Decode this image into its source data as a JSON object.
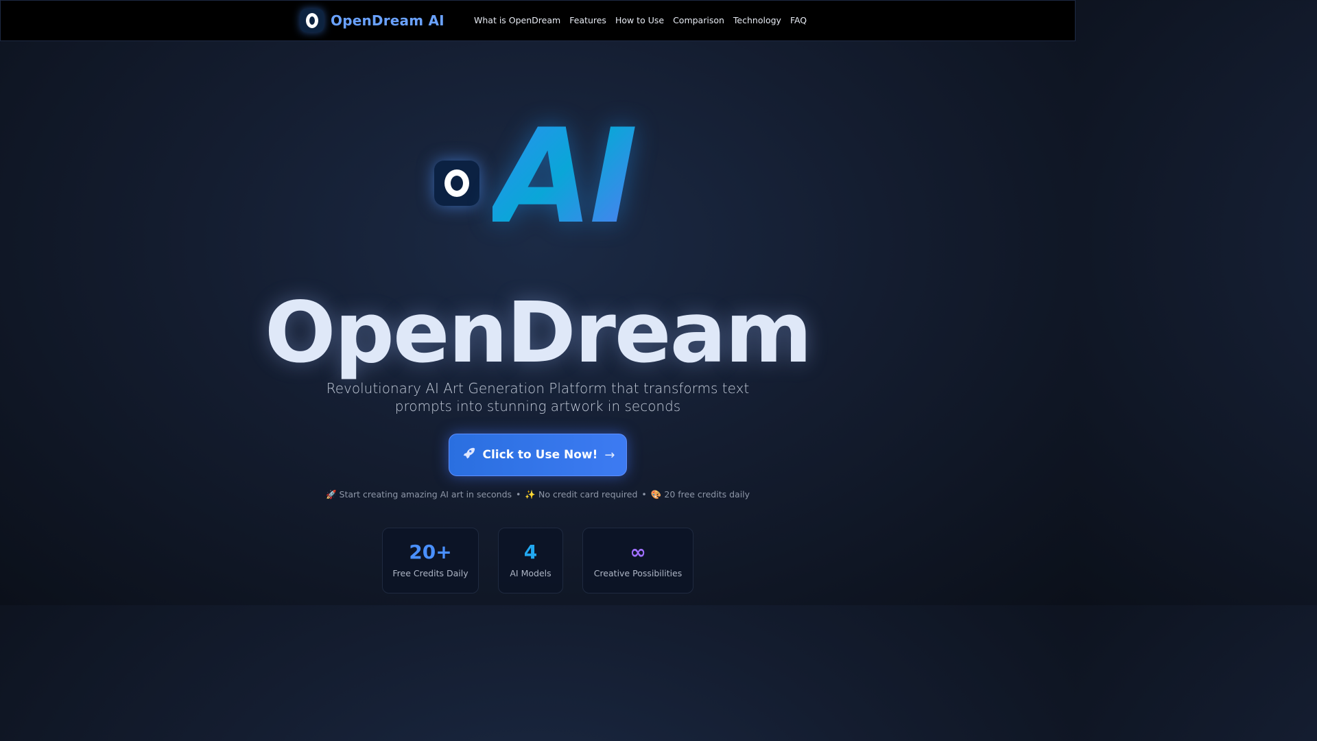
{
  "nav": {
    "brand": "OpenDream AI",
    "links": [
      "What is OpenDream",
      "Features",
      "How to Use",
      "Comparison",
      "Technology",
      "FAQ"
    ]
  },
  "hero": {
    "ai_text": "AI",
    "title": "OpenDream",
    "subtitle": "Revolutionary AI Art Generation Platform that transforms text prompts into stunning artwork in seconds",
    "cta": {
      "icon": "rocket-icon",
      "label": "Click to Use Now!",
      "arrow": "→"
    },
    "perks": [
      {
        "emoji": "🚀",
        "text": "Start creating amazing AI art in seconds"
      },
      {
        "emoji": "✨",
        "text": "No credit card required"
      },
      {
        "emoji": "🎨",
        "text": "20 free credits daily"
      }
    ],
    "separator": "•"
  },
  "stats": [
    {
      "value": "20+",
      "label": "Free Credits Daily",
      "color": "#4a90ff"
    },
    {
      "value": "4",
      "label": "AI Models",
      "color": "#22a8f0"
    },
    {
      "value": "∞",
      "label": "Creative Possibilities",
      "color": "#a070ff"
    }
  ],
  "colors": {
    "accent": "#3d7bf2",
    "brand_text": "#6aa2ff",
    "background": "#141d30"
  }
}
